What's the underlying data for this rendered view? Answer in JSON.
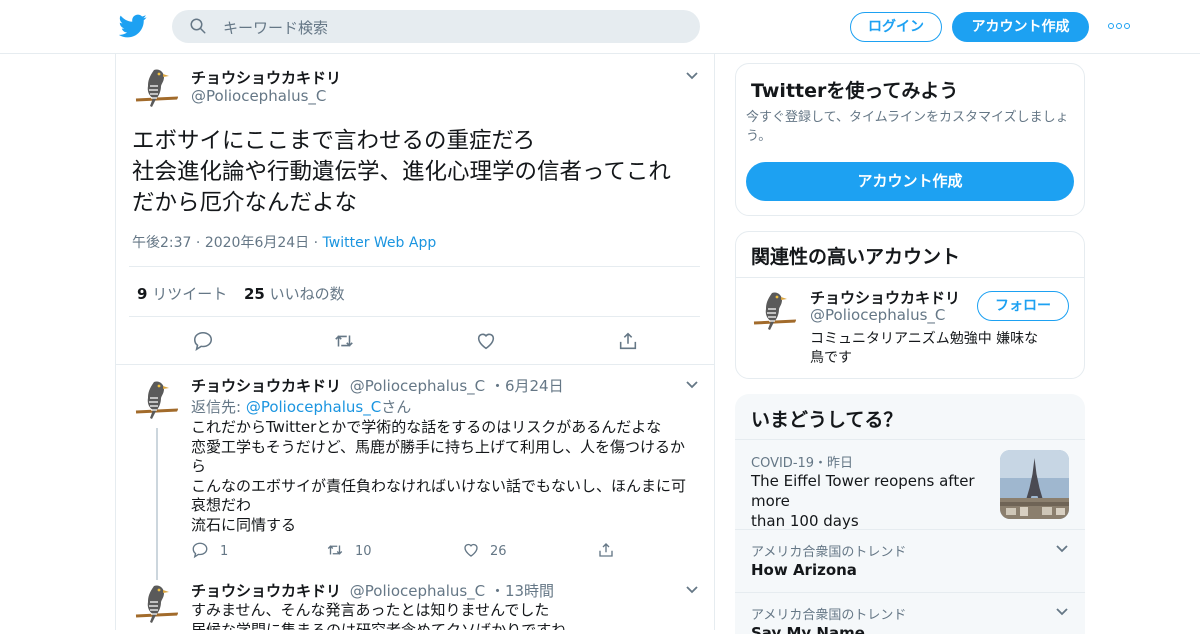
{
  "header": {
    "search_placeholder": "キーワード検索",
    "login_label": "ログイン",
    "signup_label": "アカウント作成"
  },
  "tweet": {
    "author_name": "チョウショウカキドリ",
    "author_handle": "@Poliocephalus_C",
    "text_lines": [
      "エボサイにここまで言わせるの重症だろ",
      "社会進化論や行動遺伝学、進化心理学の信者ってこれ",
      "だから厄介なんだよな"
    ],
    "time": "午後2:37",
    "date": "2020年6月24日",
    "source": "Twitter Web App",
    "retweet_count": "9",
    "retweet_label": "リツイート",
    "like_count": "25",
    "like_label": "いいねの数"
  },
  "replies": [
    {
      "author_name": "チョウショウカキドリ",
      "author_handle": "@Poliocephalus_C",
      "time": "6月24日",
      "reply_to_prefix": "返信先: ",
      "reply_to_handle": "@Poliocephalus_C",
      "reply_to_suffix": "さん",
      "text_lines": [
        "これだからTwitterとかで学術的な話をするのはリスクがあるんだよな",
        "恋愛工学もそうだけど、馬鹿が勝手に持ち上げて利用し、人を傷つけるか",
        "ら",
        "こんなのエボサイが責任負わなければいけない話でもないし、ほんまに可",
        "哀想だわ",
        "流石に同情する"
      ],
      "reply_count": "1",
      "retweet_count": "10",
      "like_count": "26"
    },
    {
      "author_name": "チョウショウカキドリ",
      "author_handle": "@Poliocephalus_C",
      "time": "13時間",
      "text_lines": [
        "すみません、そんな発言あったとは知りませんでした",
        "居候な学問に集まるのは研究者含めてクソばかりですね"
      ]
    }
  ],
  "sidebar": {
    "signup_card": {
      "title": "Twitterを使ってみよう",
      "desc_line1": "今すぐ登録して、タイムラインをカスタマイズしましょ",
      "desc_line2": "う。",
      "button": "アカウント作成"
    },
    "related": {
      "title": "関連性の高いアカウント",
      "name": "チョウショウカキドリ",
      "handle": "@Poliocephalus_C",
      "follow_label": "フォロー",
      "bio_line1": "コミュニタリアニズム勉強中 嫌味な",
      "bio_line2": "鳥です"
    },
    "trends": {
      "title": "いまどうしてる？",
      "items": [
        {
          "context": "COVID-19・昨日",
          "title_line1": "The Eiffel Tower reopens after more",
          "title_line2": "than 100 days"
        },
        {
          "context": "アメリカ合衆国のトレンド",
          "title": "How Arizona"
        },
        {
          "context": "アメリカ合衆国のトレンド",
          "title": "Say My Name"
        }
      ]
    }
  },
  "colors": {
    "accent": "#1da1f2",
    "link": "#1b95e0",
    "muted": "#657786",
    "border": "#e6ecf0"
  },
  "icons": [
    "twitter-bird-icon",
    "search-icon",
    "more-icon",
    "chevron-down-icon",
    "reply-icon",
    "retweet-icon",
    "like-icon",
    "share-icon",
    "avatar-bird"
  ]
}
